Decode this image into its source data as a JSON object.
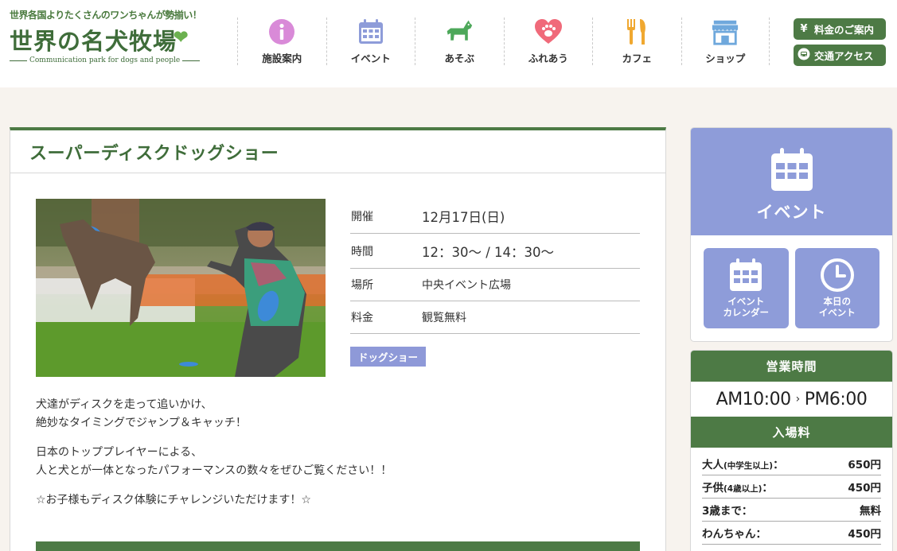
{
  "logo": {
    "tagline": "世界各国よりたくさんのワンちゃんが勢揃い！",
    "name": "世界の名犬牧場",
    "subtitle": "Communication park for dogs and people"
  },
  "nav": [
    {
      "label": "施設案内",
      "icon": "info-icon",
      "color": "#d98ad8"
    },
    {
      "label": "イベント",
      "icon": "calendar-icon",
      "color": "#8e9cd9"
    },
    {
      "label": "あそぶ",
      "icon": "dog-icon",
      "color": "#4da85a"
    },
    {
      "label": "ふれあう",
      "icon": "heart-paw-icon",
      "color": "#f06a7a"
    },
    {
      "label": "カフェ",
      "icon": "cutlery-icon",
      "color": "#f0a830"
    },
    {
      "label": "ショップ",
      "icon": "shop-icon",
      "color": "#6fa8dc"
    }
  ],
  "header_buttons": {
    "fees": "料金のご案内",
    "fees_icon": "¥",
    "access": "交通アクセス"
  },
  "event": {
    "title": "スーパーディスクドッグショー",
    "info": [
      {
        "key": "開催",
        "value": "12月17日(日)"
      },
      {
        "key": "時間",
        "value": "12：30〜 / 14：30〜"
      },
      {
        "key": "場所",
        "value": "中央イベント広場"
      },
      {
        "key": "料金",
        "value": "観覧無料"
      }
    ],
    "tag": "ドッグショー",
    "desc": [
      [
        "犬達がディスクを走って追いかけ、",
        "絶妙なタイミングでジャンプ＆キャッチ！"
      ],
      [
        "日本のトッププレイヤーによる、",
        "人と犬とが一体となったパフォーマンスの数々をぜひご覧ください！！"
      ],
      [
        "☆お子様もディスク体験にチャレンジいただけます！☆"
      ]
    ]
  },
  "sidebar": {
    "event_main": "イベント",
    "calendar_btn": "イベント\nカレンダー",
    "today_btn": "本日の\nイベント",
    "hours_title": "営業時間",
    "hours_open": "AM10:00",
    "hours_close": "PM6:00",
    "fee_title": "入場料",
    "fees": [
      {
        "label": "大人",
        "note": "(中学生以上)",
        "suffix": "：",
        "price": "650円"
      },
      {
        "label": "子供",
        "note": "(4歳以上)",
        "suffix": "：",
        "price": "450円"
      },
      {
        "label": "3歳まで",
        "note": "",
        "suffix": "：",
        "price": "無料"
      },
      {
        "label": "わんちゃん",
        "note": "",
        "suffix": "：",
        "price": "450円"
      }
    ]
  },
  "colors": {
    "green": "#4d7a45",
    "lavender": "#8e9cd9"
  }
}
